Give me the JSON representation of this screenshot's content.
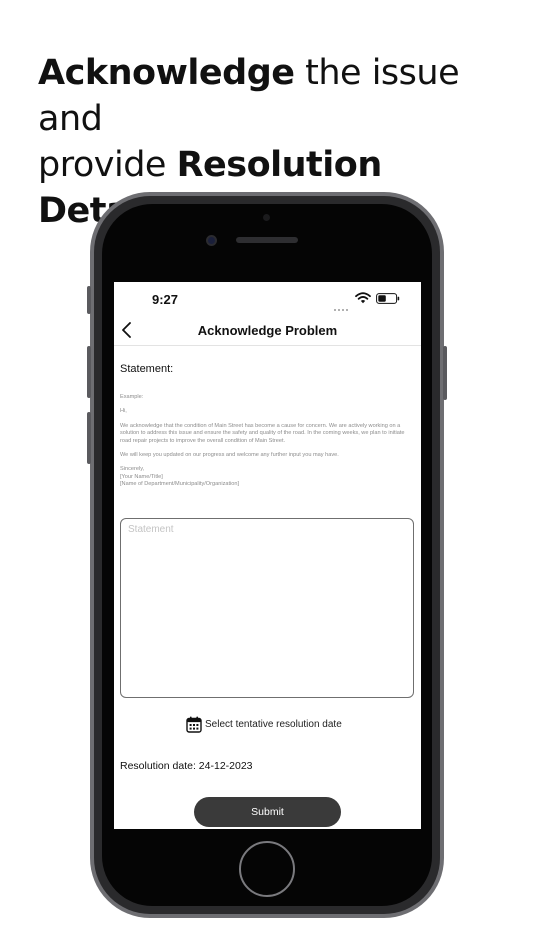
{
  "headline": {
    "bold_1": "Acknowledge",
    "text_1": " the issue and",
    "text_2": "provide ",
    "bold_2": "Resolution Details."
  },
  "status_bar": {
    "time": "9:27"
  },
  "nav": {
    "title": "Acknowledge Problem",
    "back_icon": "chevron-left-icon"
  },
  "form": {
    "statement_label": "Statement:",
    "example": {
      "heading": "Example:",
      "greeting": "Hi,",
      "paragraph_1": "We acknowledge that the condition of Main Street has become a cause for concern. We are actively working on a solution to address this issue and ensure the safety and quality of the road. In the coming weeks, we plan to initiate road repair projects to improve the overall condition of Main Street.",
      "paragraph_2": "We will keep you updated on our progress and welcome any further input you may have.",
      "closing": "Sincerely,",
      "name_line": "[Your Name/Title]",
      "org_line": "[Name of Department/Municipality/Organization]"
    },
    "statement_value": "",
    "statement_placeholder": "Statement",
    "date_select_label": "Select tentative resolution date",
    "date_select_icon": "calendar-icon",
    "resolution_date": "Resolution date: 24-12-2023",
    "submit_label": "Submit"
  },
  "colors": {
    "button_bg": "#3a3a3a",
    "text": "#111111",
    "example_text": "#8c8c8c",
    "input_border": "#6f6f6f"
  }
}
